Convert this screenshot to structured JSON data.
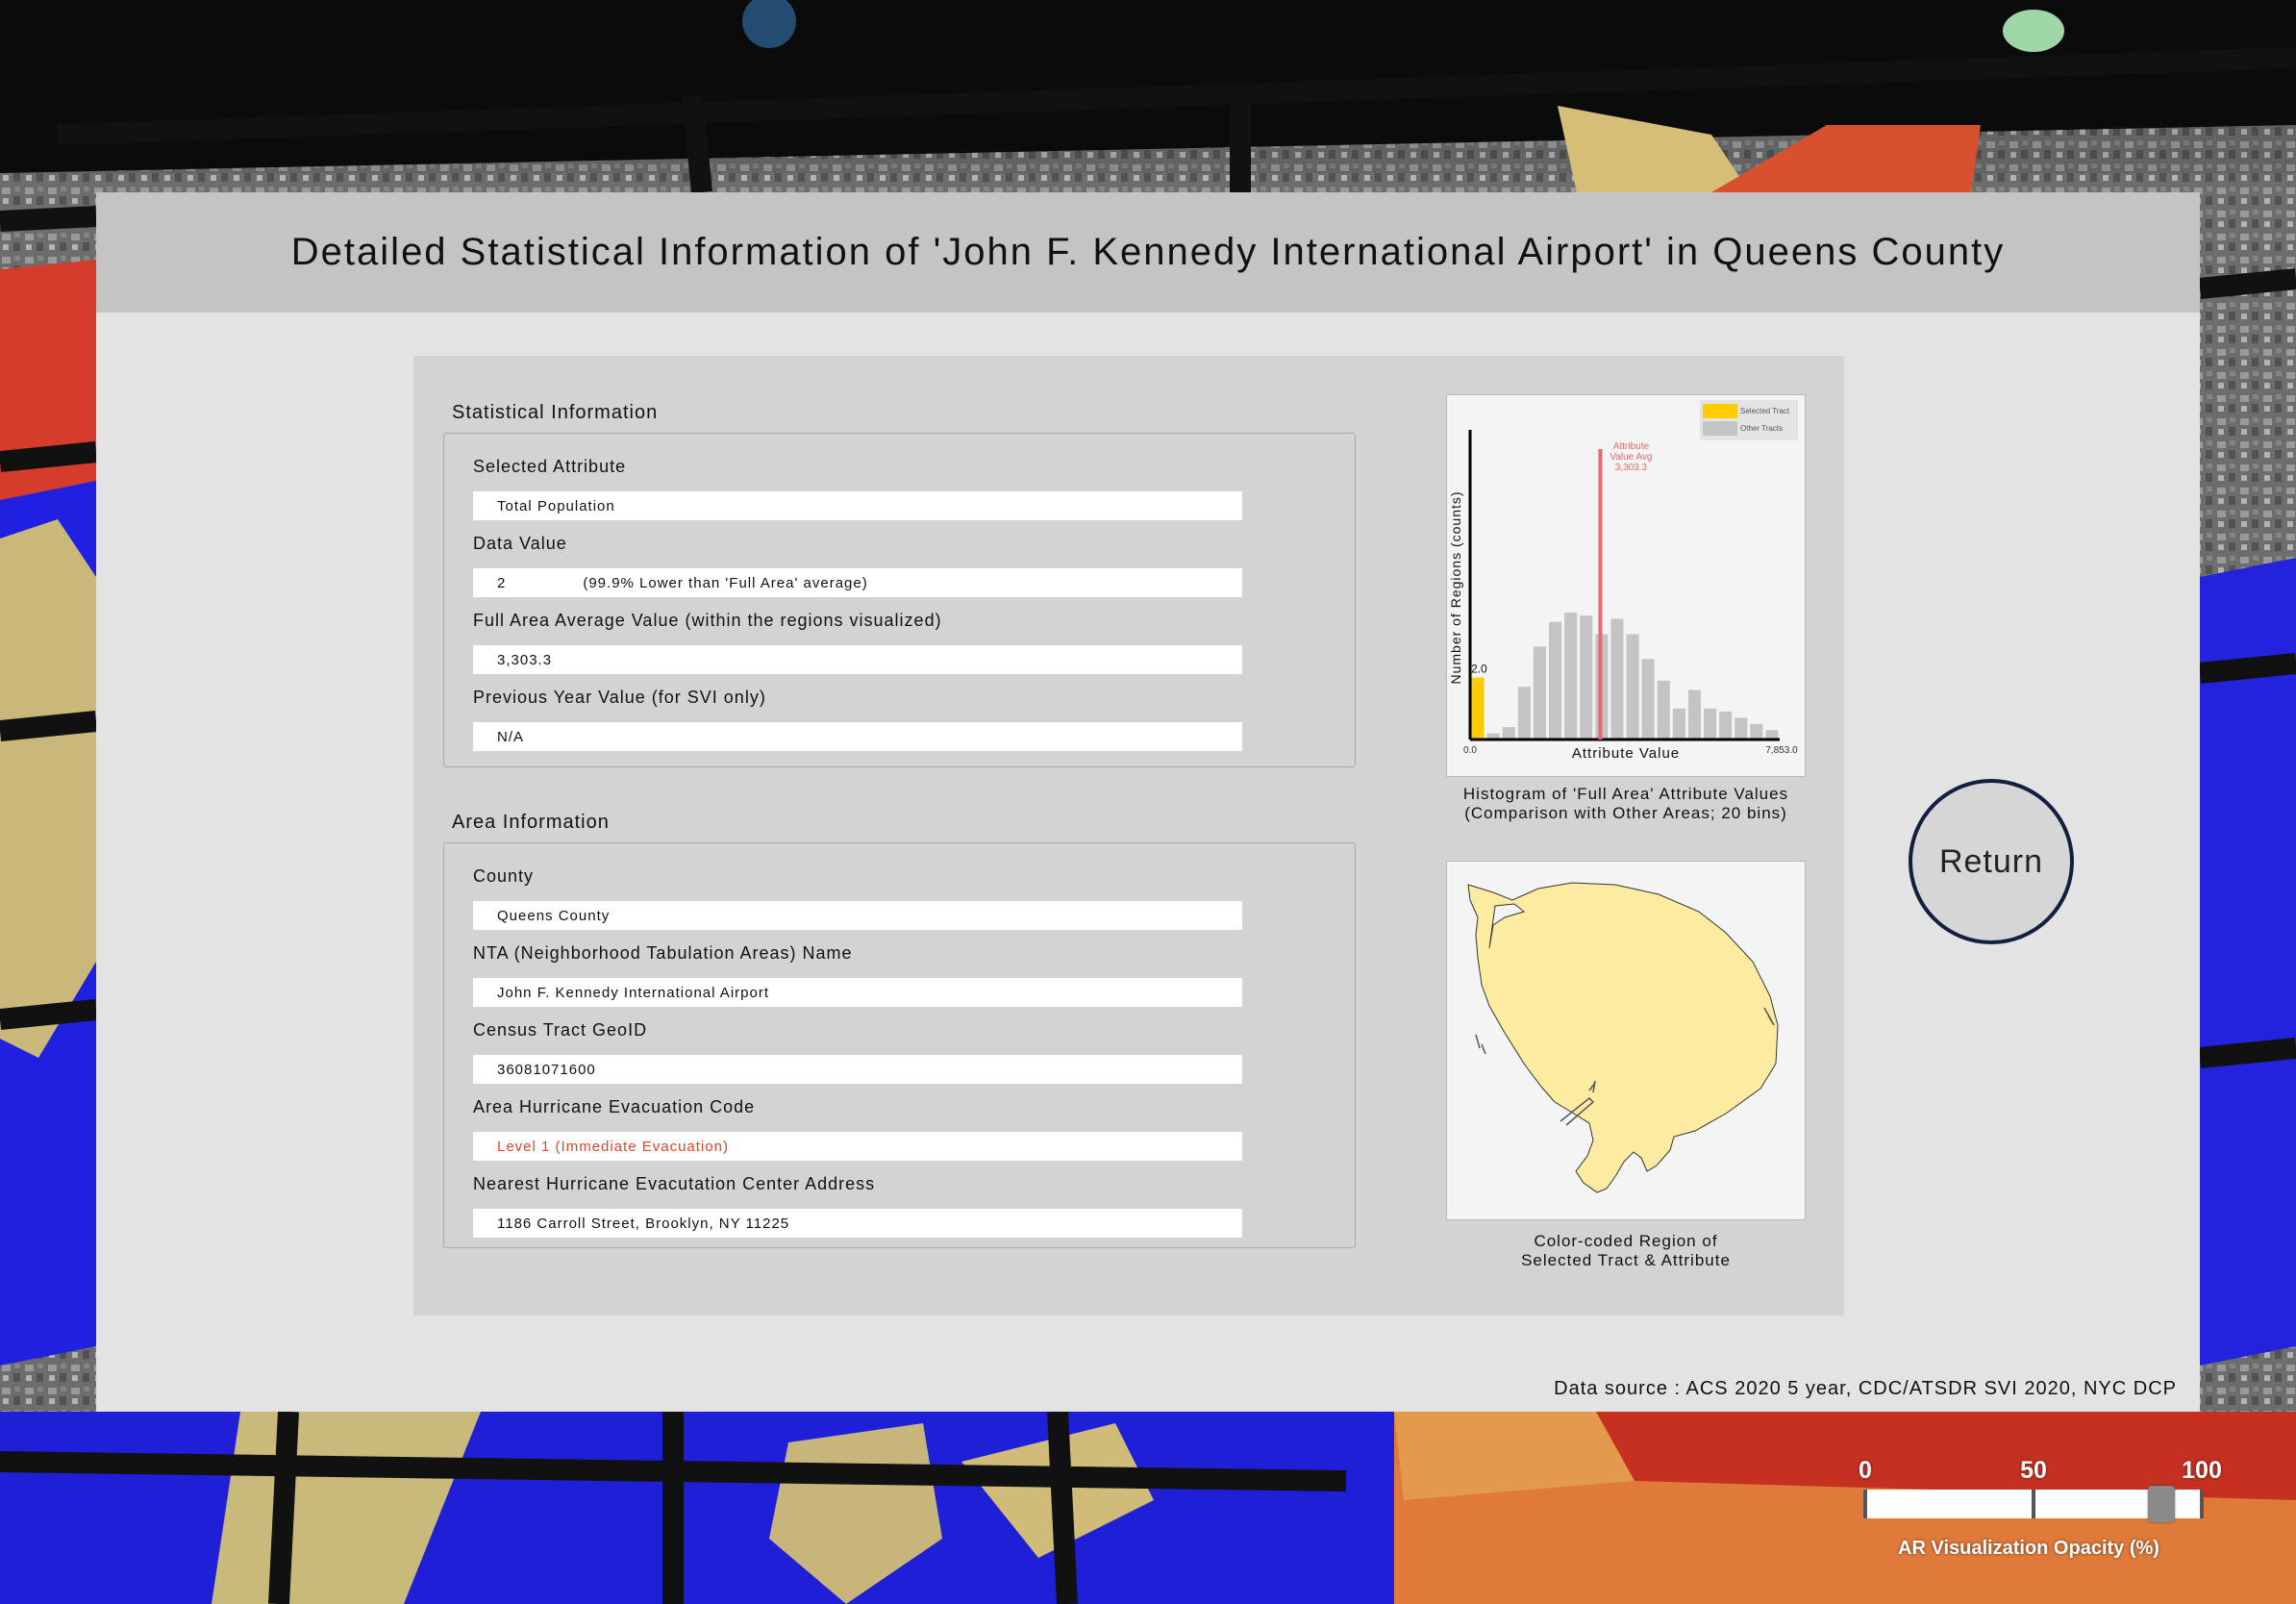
{
  "header": {
    "title": "Detailed Statistical Information of 'John F. Kennedy International Airport' in Queens County"
  },
  "statistical": {
    "section_title": "Statistical Information",
    "selected_attribute_label": "Selected Attribute",
    "selected_attribute_value": "Total Population",
    "data_value_label": "Data Value",
    "data_value": "2",
    "data_value_comparison": "(99.9% Lower than 'Full Area' average)",
    "full_avg_label": "Full Area Average Value (within the regions visualized)",
    "full_avg_value": "3,303.3",
    "prev_year_label": "Previous Year Value (for SVI only)",
    "prev_year_value": "N/A"
  },
  "area": {
    "section_title": "Area Information",
    "county_label": "County",
    "county_value": "Queens County",
    "nta_label": "NTA (Neighborhood Tabulation Areas) Name",
    "nta_value": "John F. Kennedy International Airport",
    "geoid_label": "Census Tract GeoID",
    "geoid_value": "36081071600",
    "evac_code_label": "Area Hurricane Evacuation Code",
    "evac_code_value": "Level 1 (Immediate Evacuation)",
    "evac_center_label": "Nearest Hurricane Evacutation Center Address",
    "evac_center_value": "1186 Carroll Street, Brooklyn, NY 11225"
  },
  "chart_data": {
    "type": "bar",
    "title": "",
    "xlabel": "Attribute Value",
    "ylabel": "Number of Regions (counts)",
    "x_tick_labels": [
      "0.0",
      "7,853.0"
    ],
    "xlim": [
      0,
      7853
    ],
    "ylim": [
      0,
      10
    ],
    "grid": false,
    "legend_position": "top-right",
    "bins": 20,
    "series": [
      {
        "name": "Selected Tract",
        "color": "#ffcc00",
        "values": [
          2,
          0,
          0,
          0,
          0,
          0,
          0,
          0,
          0,
          0,
          0,
          0,
          0,
          0,
          0,
          0,
          0,
          0,
          0,
          0
        ]
      },
      {
        "name": "Other Tracts",
        "color": "#c4c4c4",
        "values": [
          0,
          0.2,
          0.4,
          1.7,
          3.0,
          3.8,
          4.1,
          4.0,
          3.4,
          3.9,
          3.4,
          2.6,
          1.9,
          1.0,
          1.6,
          1.0,
          0.9,
          0.7,
          0.5,
          0.3
        ]
      }
    ],
    "selected_value_label": "2.0",
    "selected_value": 2,
    "avg_line": {
      "value": 3303.3,
      "label_lines": [
        "Attribute",
        "Value Avg",
        "3,303.3"
      ],
      "color": "#e36b6b"
    }
  },
  "histogram_caption": {
    "line1": "Histogram of 'Full Area' Attribute Values",
    "line2": "(Comparison with Other Areas; 20 bins)"
  },
  "map": {
    "region_color": "#fdeba2",
    "caption_line1": "Color-coded Region of",
    "caption_line2": "Selected Tract & Attribute"
  },
  "source": "Data source : ACS 2020 5 year, CDC/ATSDR SVI 2020, NYC DCP",
  "return_button": "Return",
  "opacity_slider": {
    "label": "AR Visualization Opacity (%)",
    "ticks": [
      "0",
      "50",
      "100"
    ],
    "value": 88
  }
}
